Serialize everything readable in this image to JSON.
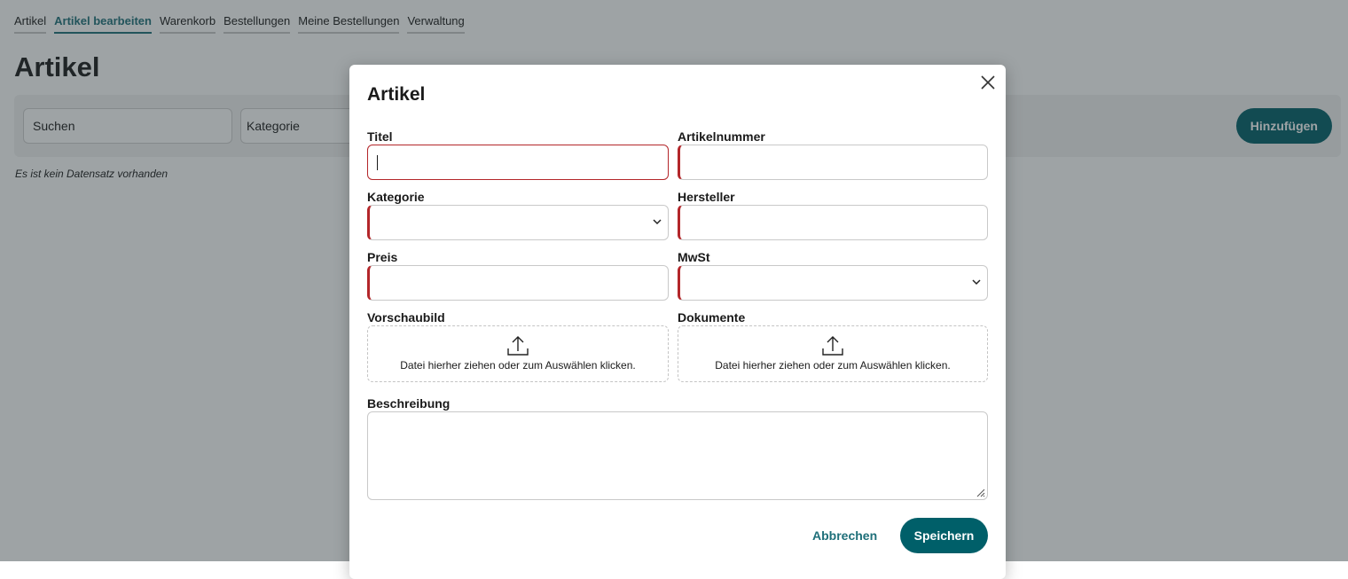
{
  "nav": {
    "items": [
      "Artikel",
      "Artikel bearbeiten",
      "Warenkorb",
      "Bestellungen",
      "Meine Bestellungen",
      "Verwaltung"
    ],
    "active_index": 1
  },
  "page": {
    "title": "Artikel",
    "search_placeholder": "Suchen",
    "category_placeholder": "Kategorie",
    "add_label": "Hinzufügen",
    "empty_text": "Es ist kein Datensatz vorhanden"
  },
  "modal": {
    "title": "Artikel",
    "fields": {
      "titel": {
        "label": "Titel",
        "value": ""
      },
      "artikelnummer": {
        "label": "Artikelnummer",
        "value": ""
      },
      "kategorie": {
        "label": "Kategorie",
        "value": ""
      },
      "hersteller": {
        "label": "Hersteller",
        "value": ""
      },
      "preis": {
        "label": "Preis",
        "value": ""
      },
      "mwst": {
        "label": "MwSt",
        "value": ""
      },
      "vorschaubild": {
        "label": "Vorschaubild",
        "hint": "Datei hierher ziehen oder zum Auswählen klicken."
      },
      "dokumente": {
        "label": "Dokumente",
        "hint": "Datei hierher ziehen oder zum Auswählen klicken."
      },
      "beschreibung": {
        "label": "Beschreibung",
        "value": ""
      }
    },
    "cancel_label": "Abbrechen",
    "save_label": "Speichern"
  },
  "colors": {
    "accent": "#005f69",
    "accent_text": "#1e6f79",
    "required": "#b3262a"
  },
  "icons": {
    "close": "close-icon",
    "chevron": "chevron-down-icon",
    "upload": "upload-icon",
    "resize": "resize-handle-icon"
  }
}
